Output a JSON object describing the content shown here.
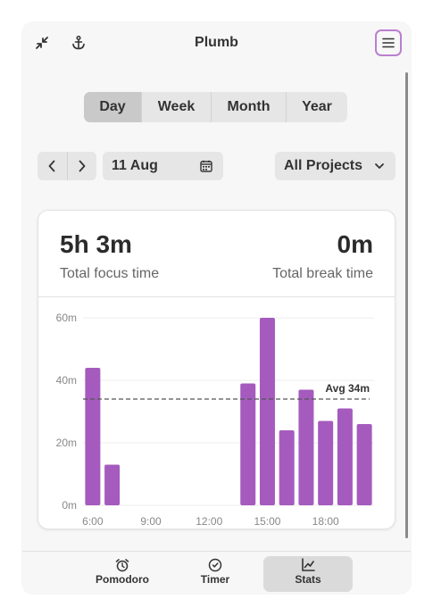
{
  "header": {
    "title": "Plumb",
    "left_icons": [
      "collapse-icon",
      "anchor-icon"
    ],
    "menu_icon": "hamburger-menu-icon"
  },
  "period_tabs": [
    {
      "label": "Day",
      "active": true
    },
    {
      "label": "Week",
      "active": false
    },
    {
      "label": "Month",
      "active": false
    },
    {
      "label": "Year",
      "active": false
    }
  ],
  "date_nav": {
    "date_value": "11 Aug",
    "prev_icon": "chevron-left-icon",
    "next_icon": "chevron-right-icon",
    "calendar_icon": "calendar-icon"
  },
  "project_filter": {
    "selected": "All Projects",
    "icon": "chevron-down-icon"
  },
  "stats": {
    "focus_value": "5h 3m",
    "focus_label": "Total focus time",
    "break_value": "0m",
    "break_label": "Total break time"
  },
  "chart_data": {
    "type": "bar",
    "x_unit": "hour",
    "x": [
      6,
      7,
      14,
      15,
      16,
      17,
      18,
      19,
      20
    ],
    "values": [
      44,
      13,
      39,
      60,
      24,
      37,
      27,
      31,
      26
    ],
    "ylim": [
      0,
      60
    ],
    "yticks": [
      "0m",
      "20m",
      "40m",
      "60m"
    ],
    "ytick_values": [
      0,
      20,
      40,
      60
    ],
    "xticks": [
      "6:00",
      "9:00",
      "12:00",
      "15:00",
      "18:00"
    ],
    "xtick_values": [
      6,
      9,
      12,
      15,
      18
    ],
    "xlim": [
      5.5,
      20.5
    ],
    "average": {
      "value": 34,
      "label": "Avg 34m"
    },
    "grid": true,
    "bar_color": "#a55bbd"
  },
  "bottom_nav": [
    {
      "label": "Pomodoro",
      "icon": "alarm-clock-icon",
      "active": false
    },
    {
      "label": "Timer",
      "icon": "timer-icon",
      "active": false
    },
    {
      "label": "Stats",
      "icon": "stats-chart-icon",
      "active": true
    }
  ],
  "colors": {
    "accent": "#a55bbd",
    "menu_border": "#b97fd1",
    "background": "#f7f7f7"
  }
}
